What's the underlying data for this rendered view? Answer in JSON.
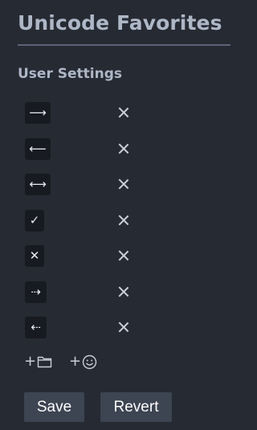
{
  "panel": {
    "title": "Unicode Favorites",
    "section_title": "User Settings"
  },
  "favorites": [
    {
      "glyph": "⟶",
      "remove_icon": "close-icon"
    },
    {
      "glyph": "⟵",
      "remove_icon": "close-icon"
    },
    {
      "glyph": "⟷",
      "remove_icon": "close-icon"
    },
    {
      "glyph": "✓",
      "remove_icon": "close-icon"
    },
    {
      "glyph": "✕",
      "remove_icon": "close-icon"
    },
    {
      "glyph": "⇢",
      "remove_icon": "close-icon"
    },
    {
      "glyph": "⇠",
      "remove_icon": "close-icon"
    }
  ],
  "add_actions": {
    "add_folder": {
      "symbol": "+",
      "icon": "folder-icon"
    },
    "add_emoji": {
      "symbol": "+",
      "icon": "smiley-icon"
    }
  },
  "buttons": {
    "save_label": "Save",
    "revert_label": "Revert"
  },
  "colors": {
    "background": "#262a33",
    "heading": "#aeb7c6",
    "chip": "#171a20",
    "button": "#3d4452"
  }
}
